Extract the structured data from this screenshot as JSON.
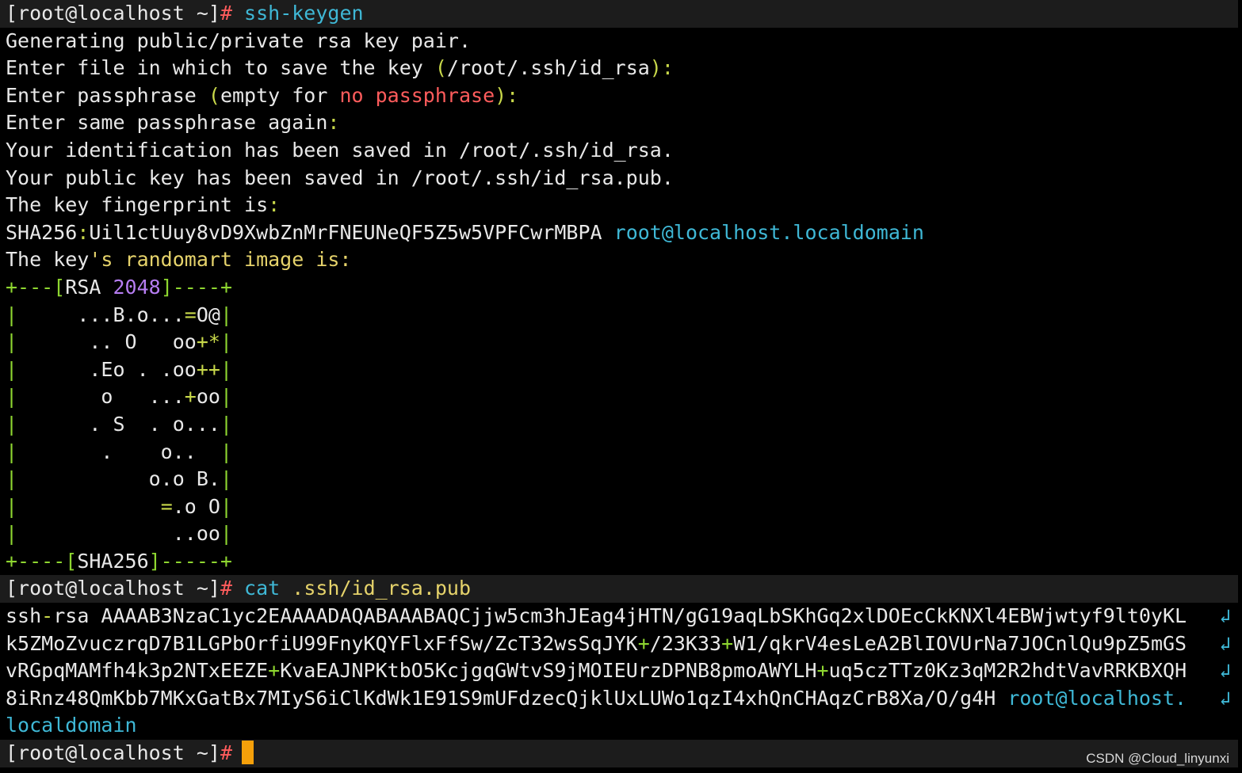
{
  "terminal": {
    "lines": [
      {
        "type": "prompt",
        "segments": [
          {
            "text": "[root@localhost ~]",
            "color": "#e8e8e8"
          },
          {
            "text": "# ",
            "color": "#ff5c5c"
          },
          {
            "text": "ssh-keygen",
            "color": "#3fb8d6"
          }
        ]
      },
      {
        "segments": [
          {
            "text": "Generating public/private rsa key pair.",
            "color": "#e8e8e8"
          }
        ]
      },
      {
        "segments": [
          {
            "text": "Enter file in which to save the key ",
            "color": "#e8e8e8"
          },
          {
            "text": "(",
            "color": "#c8d84a"
          },
          {
            "text": "/root/.ssh/id_rsa",
            "color": "#e8e8e8"
          },
          {
            "text": "):",
            "color": "#c8d84a"
          }
        ]
      },
      {
        "segments": [
          {
            "text": "Enter passphrase ",
            "color": "#e8e8e8"
          },
          {
            "text": "(",
            "color": "#c8d84a"
          },
          {
            "text": "empty for ",
            "color": "#e8e8e8"
          },
          {
            "text": "no passphrase",
            "color": "#ff5c5c"
          },
          {
            "text": "):",
            "color": "#c8d84a"
          }
        ]
      },
      {
        "segments": [
          {
            "text": "Enter same passphrase again",
            "color": "#e8e8e8"
          },
          {
            "text": ":",
            "color": "#c8d84a"
          }
        ]
      },
      {
        "segments": [
          {
            "text": "Your identification has been saved in /root/.ssh/id_rsa.",
            "color": "#e8e8e8"
          }
        ]
      },
      {
        "segments": [
          {
            "text": "Your public key has been saved in /root/.ssh/id_rsa.pub.",
            "color": "#e8e8e8"
          }
        ]
      },
      {
        "segments": [
          {
            "text": "The key fingerprint is",
            "color": "#e8e8e8"
          },
          {
            "text": ":",
            "color": "#c8d84a"
          }
        ]
      },
      {
        "segments": [
          {
            "text": "SHA256",
            "color": "#e8e8e8"
          },
          {
            "text": ":",
            "color": "#c8d84a"
          },
          {
            "text": "Uil1ctUuy8vD9XwbZnMrFNEUNeQF5Z5w5VPFCwrMBPA ",
            "color": "#e8e8e8"
          },
          {
            "text": "root@localhost.localdomain",
            "color": "#3fb8d6"
          }
        ]
      },
      {
        "segments": [
          {
            "text": "The key",
            "color": "#e8e8e8"
          },
          {
            "text": "'s randomart image is:",
            "color": "#e6d36b"
          }
        ]
      },
      {
        "segments": [
          {
            "text": "+---[",
            "color": "#8ed630"
          },
          {
            "text": "RSA ",
            "color": "#e8e8e8"
          },
          {
            "text": "2048",
            "color": "#b67df2"
          },
          {
            "text": "]----+",
            "color": "#8ed630"
          }
        ]
      },
      {
        "segments": [
          {
            "text": "|",
            "color": "#8ed630"
          },
          {
            "text": "     ...B.o...",
            "color": "#e8e8e8"
          },
          {
            "text": "=",
            "color": "#c8d84a"
          },
          {
            "text": "O@",
            "color": "#e8e8e8"
          },
          {
            "text": "|",
            "color": "#8ed630"
          }
        ]
      },
      {
        "segments": [
          {
            "text": "|",
            "color": "#8ed630"
          },
          {
            "text": "      .. O   oo",
            "color": "#e8e8e8"
          },
          {
            "text": "+*",
            "color": "#c8d84a"
          },
          {
            "text": "|",
            "color": "#8ed630"
          }
        ]
      },
      {
        "segments": [
          {
            "text": "|",
            "color": "#8ed630"
          },
          {
            "text": "      .Eo . .oo",
            "color": "#e8e8e8"
          },
          {
            "text": "++",
            "color": "#c8d84a"
          },
          {
            "text": "|",
            "color": "#8ed630"
          }
        ]
      },
      {
        "segments": [
          {
            "text": "|",
            "color": "#8ed630"
          },
          {
            "text": "       o   ...",
            "color": "#e8e8e8"
          },
          {
            "text": "+",
            "color": "#c8d84a"
          },
          {
            "text": "oo",
            "color": "#e8e8e8"
          },
          {
            "text": "|",
            "color": "#8ed630"
          }
        ]
      },
      {
        "segments": [
          {
            "text": "|",
            "color": "#8ed630"
          },
          {
            "text": "      . S  . o...",
            "color": "#e8e8e8"
          },
          {
            "text": "|",
            "color": "#8ed630"
          }
        ]
      },
      {
        "segments": [
          {
            "text": "|",
            "color": "#8ed630"
          },
          {
            "text": "       .    o..  ",
            "color": "#e8e8e8"
          },
          {
            "text": "|",
            "color": "#8ed630"
          }
        ]
      },
      {
        "segments": [
          {
            "text": "|",
            "color": "#8ed630"
          },
          {
            "text": "           o.o B.",
            "color": "#e8e8e8"
          },
          {
            "text": "|",
            "color": "#8ed630"
          }
        ]
      },
      {
        "segments": [
          {
            "text": "|",
            "color": "#8ed630"
          },
          {
            "text": "            ",
            "color": "#e8e8e8"
          },
          {
            "text": "=",
            "color": "#c8d84a"
          },
          {
            "text": ".o O",
            "color": "#e8e8e8"
          },
          {
            "text": "|",
            "color": "#8ed630"
          }
        ]
      },
      {
        "segments": [
          {
            "text": "|",
            "color": "#8ed630"
          },
          {
            "text": "             ..oo",
            "color": "#e8e8e8"
          },
          {
            "text": "|",
            "color": "#8ed630"
          }
        ]
      },
      {
        "segments": [
          {
            "text": "+----[",
            "color": "#8ed630"
          },
          {
            "text": "SHA256",
            "color": "#e8e8e8"
          },
          {
            "text": "]-----+",
            "color": "#8ed630"
          }
        ]
      },
      {
        "type": "prompt",
        "segments": [
          {
            "text": "[root@localhost ~]",
            "color": "#e8e8e8"
          },
          {
            "text": "# ",
            "color": "#ff5c5c"
          },
          {
            "text": "cat ",
            "color": "#3fb8d6"
          },
          {
            "text": ".ssh/id_rsa.pub",
            "color": "#e6d36b"
          }
        ]
      },
      {
        "wrap": true,
        "segments": [
          {
            "text": "ssh",
            "color": "#e8e8e8"
          },
          {
            "text": "-",
            "color": "#c8d84a"
          },
          {
            "text": "rsa AAAAB3NzaC1yc2EAAAADAQABAAABAQCjjw5cm3hJEag4jHTN/gG19aqLbSKhGq2xlDOEcCkKNXl4EBWjwtyf9lt0yKL",
            "color": "#e8e8e8"
          }
        ]
      },
      {
        "wrap": true,
        "segments": [
          {
            "text": "k5ZMoZvuczrqD7B1LGPbOrfiU99FnyKQYFlxFfSw/ZcT32wsSqJYK",
            "color": "#e8e8e8"
          },
          {
            "text": "+",
            "color": "#8ed630"
          },
          {
            "text": "/23K33",
            "color": "#e8e8e8"
          },
          {
            "text": "+",
            "color": "#8ed630"
          },
          {
            "text": "W1/qkrV4esLeA2BlIOVUrNa7JOCnlQu9pZ5mGS",
            "color": "#e8e8e8"
          }
        ]
      },
      {
        "wrap": true,
        "segments": [
          {
            "text": "vRGpqMAMfh4k3p2NTxEEZE",
            "color": "#e8e8e8"
          },
          {
            "text": "+",
            "color": "#8ed630"
          },
          {
            "text": "KvaEAJNPKtbO5KcjgqGWtvS9jMOIEUrzDPNB8pmoAWYLH",
            "color": "#e8e8e8"
          },
          {
            "text": "+",
            "color": "#8ed630"
          },
          {
            "text": "uq5czTTz0Kz3qM2R2hdtVavRRKBXQH",
            "color": "#e8e8e8"
          }
        ]
      },
      {
        "wrap": true,
        "segments": [
          {
            "text": "8iRnz48QmKbb7MKxGatBx7MIyS6iClKdWk1E91S9mUFdzecQjklUxLUWo1qzI4xhQnCHAqzCrB8Xa/O/g4H ",
            "color": "#e8e8e8"
          },
          {
            "text": "root@localhost.",
            "color": "#3fb8d6"
          }
        ]
      },
      {
        "segments": [
          {
            "text": "localdomain",
            "color": "#3fb8d6"
          }
        ]
      },
      {
        "type": "prompt",
        "cursor": true,
        "segments": [
          {
            "text": "[root@localhost ~]",
            "color": "#e8e8e8"
          },
          {
            "text": "#",
            "color": "#ff5c5c"
          }
        ]
      }
    ],
    "wrap_icon": "↲",
    "cursor_color": "#f5a00a"
  },
  "watermark": "CSDN @Cloud_linyunxi"
}
